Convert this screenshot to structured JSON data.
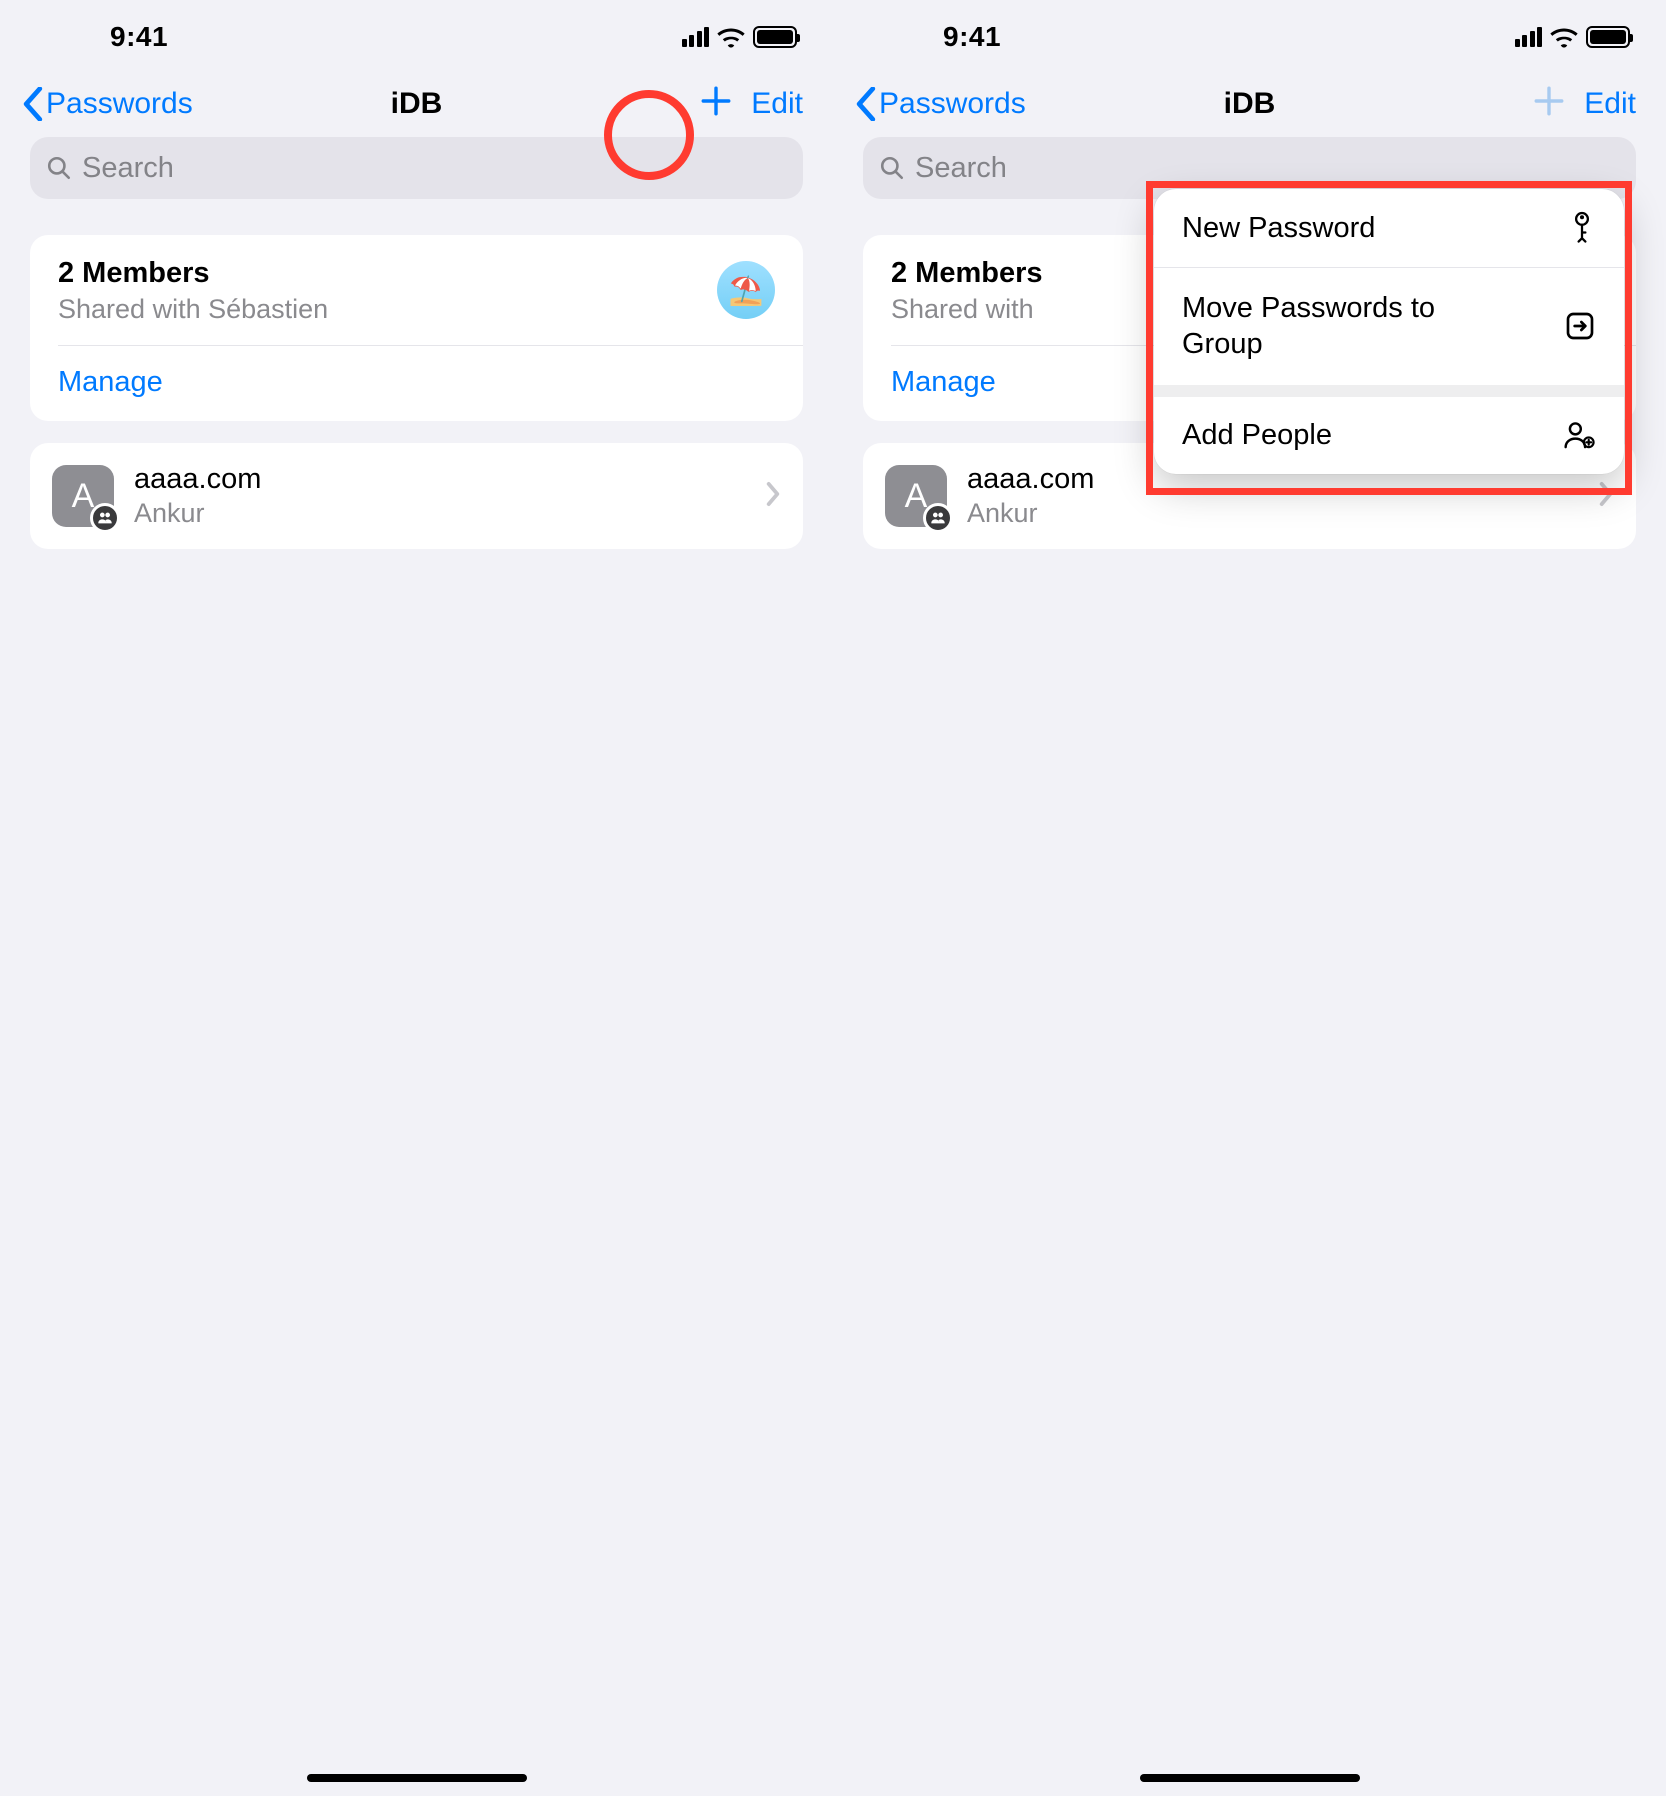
{
  "status": {
    "time": "9:41"
  },
  "nav": {
    "back_label": "Passwords",
    "title": "iDB",
    "edit_label": "Edit"
  },
  "search": {
    "placeholder": "Search"
  },
  "group": {
    "members_title": "2 Members",
    "shared_with_full": "Shared with Sébastien",
    "shared_with_truncated": "Shared with",
    "manage_label": "Manage"
  },
  "site": {
    "icon_letter": "A",
    "title": "aaaa.com",
    "subtitle": "Ankur"
  },
  "menu": {
    "new_password": "New Password",
    "move_passwords": "Move Passwords to Group",
    "add_people": "Add People"
  }
}
